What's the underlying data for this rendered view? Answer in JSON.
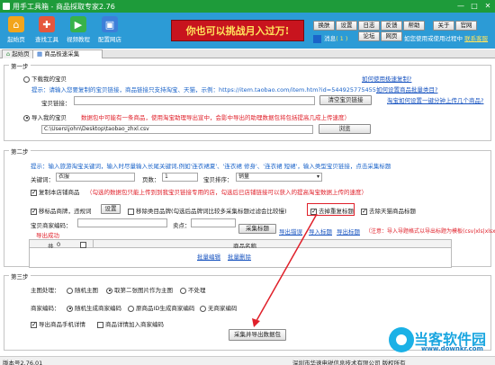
{
  "window": {
    "title": "用手工具箱 - 商品採取专家2.76"
  },
  "toolbar": {
    "items": [
      {
        "label": "起始页",
        "icon": "home-icon",
        "color": "#f2a51c"
      },
      {
        "label": "查找工具",
        "icon": "search-tools-icon",
        "color": "#e5573d"
      },
      {
        "label": "视频教程",
        "icon": "video-icon",
        "color": "#38b24a"
      },
      {
        "label": "配置网店",
        "icon": "store-config-icon",
        "color": "#3d7fd9"
      }
    ],
    "banner": "你也可以挑战月入过万!",
    "buttons": [
      "换肤",
      "设置",
      "日志",
      "反馈",
      "帮助",
      "关于",
      "官网"
    ],
    "row2_buttons": [
      "论坛",
      "网页"
    ],
    "message_label": "消息",
    "message_count": "( 1 )",
    "notice": "全网",
    "notice_text": "如您使用或使用过程中",
    "notice_link": "联系客服"
  },
  "tabs": {
    "outer": [
      "起始页",
      "商品极速采集"
    ],
    "inner": [
      "第一步",
      "第二步",
      "第三步"
    ]
  },
  "step1": {
    "legend": "第一步",
    "radio_download": "下载我的宝贝",
    "hint_prefix": "提示：请输入您要复制的宝贝链接，商品链接只支持淘宝、天猫，示例：",
    "hint_url": "https://item.taobao.com/item.htm?id=544925775455",
    "link_how_to": "如何使用极速复制?",
    "link_trans": "如何设置商品批量类目?",
    "link_taobao": "淘宝如何设置一键分钟上传几个商品?",
    "baby_link_label": "宝贝链接：",
    "clear_btn": "清空宝贝链接",
    "radio_import": "导入我的宝贝",
    "import_hint": "数据包中可能有一条商品，使用淘宝助理导出宣中，会影中导出的助理数据包将包括提高几成上传速度）",
    "file_path": "C:\\Users\\john\\Desktop\\taobao_zhxl.csv",
    "browse_btn": "浏览"
  },
  "step2": {
    "legend": "第二步",
    "hint": "提示：输入旅游淘宝关键词，输入时尽量输入长尾关键词,例如'连衣裙夏'、'连衣裙 修身'、'连衣裙 短裙'，输入类型宝贝链接，点击采集标题",
    "keyword_label": "关键词：",
    "keyword_value": "衣服",
    "pages_label": "页数：",
    "pages_value": "1",
    "sort_label": "宝贝排序：",
    "sort_value": "销量",
    "copy_check": "复制本店铺商品",
    "copy_hint": "（勾选的数据包只能上传到到我宝贝链接专用的店，勾选后已店铺链接可以获入的提高淘宝数据上传的速度）",
    "move_sale": "移标品商牌，违规词",
    "settings_btn": "设置",
    "move_violation": "移除类目品牌(勾选后品牌词比较多采集标题过滤会比较慢)",
    "remove_dup": "去掉重复标题",
    "remove_tmall": "去除天猫商品标题",
    "shop_name_label": "宝贝商家编码：",
    "sell_label": "卖点：",
    "collect_btn": "采集标题",
    "export_error": "导出错误",
    "import_title": "导入标题",
    "export_title": "导出标题",
    "note": "（注意：导入导题格式以导出标题为模板(csv|xls|xlsx)）",
    "export_success": "导出成功",
    "grid_headers": [
      "共",
      "0",
      "商品名称"
    ],
    "batch_edit": "批量编辑",
    "batch_delete": "批量删除"
  },
  "step3": {
    "legend": "第三步",
    "main_img_label": "主图处理：",
    "main_img_options": [
      "随机主图",
      "取第二张图片作为主图",
      "不处理"
    ],
    "main_img_selected": 1,
    "merchant_label": "商家编码：",
    "merchant_options": [
      "随机生成商家编码",
      "原商品ID生成商家编码",
      "无商家编码"
    ],
    "merchant_selected": 0,
    "export_mobile": "导出商品手机详情",
    "import_detail": "商品详情加入商家编码",
    "submit_btn": "采集并导出数据包"
  },
  "status": {
    "version": "版本号2.76.01",
    "company": "深圳市华速电锐信息技术有限公司 版权所有"
  },
  "watermark": {
    "name": "当客软件园",
    "url": "www.downkr.com"
  }
}
